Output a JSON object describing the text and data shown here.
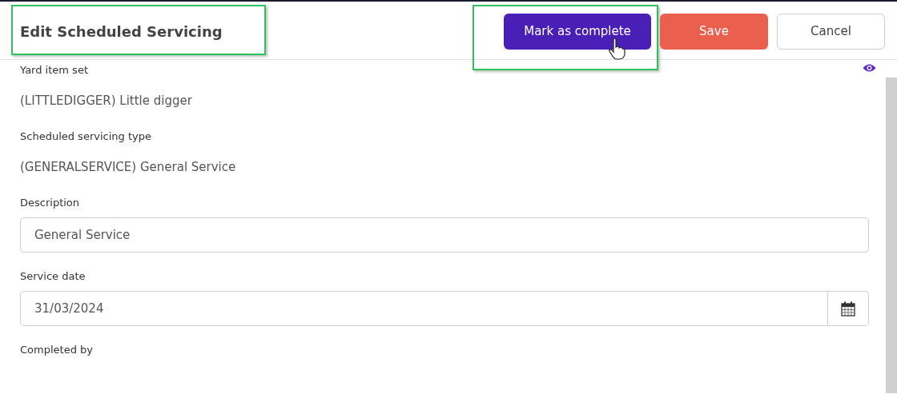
{
  "header": {
    "title": "Edit Scheduled Servicing",
    "highlighted": true,
    "buttons": [
      {
        "label": "Mark as complete",
        "kind": "primary",
        "highlighted": true,
        "hovered": true
      },
      {
        "label": "Save",
        "kind": "danger",
        "highlighted": false,
        "hovered": false
      },
      {
        "label": "Cancel",
        "kind": "secondary",
        "highlighted": false,
        "hovered": false
      }
    ]
  },
  "fields": [
    {
      "kind": "readonly",
      "label": "Yard item set",
      "value": "(LITTLEDIGGER) Little digger",
      "eye": true
    },
    {
      "kind": "readonly",
      "label": "Scheduled servicing type",
      "value": "(GENERALSERVICE) General Service",
      "eye": false
    },
    {
      "kind": "text",
      "label": "Description",
      "value": "General Service"
    },
    {
      "kind": "date",
      "label": "Service date",
      "value": "31/03/2024"
    },
    {
      "kind": "empty",
      "label": "Completed by"
    }
  ]
}
